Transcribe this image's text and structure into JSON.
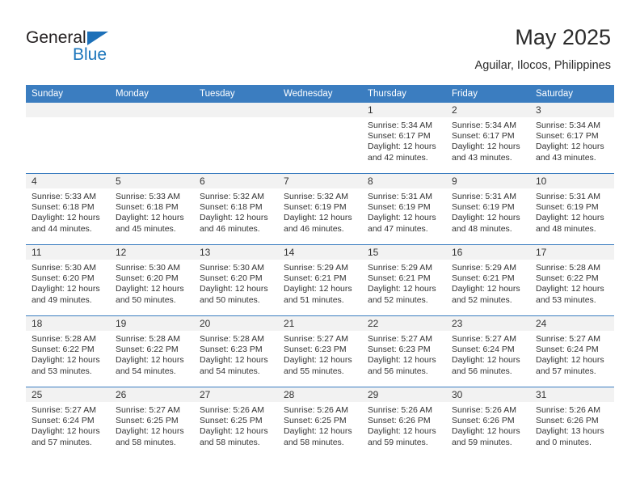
{
  "brand": {
    "name_top": "General",
    "name_bottom": "Blue",
    "triangle_color": "#1d70b8",
    "blue_color": "#1b75bb"
  },
  "header": {
    "month_title": "May 2025",
    "location": "Aguilar, Ilocos, Philippines"
  },
  "theme": {
    "header_blue": "#3b7dc0",
    "daynum_band": "#f2f2f2",
    "text": "#333333"
  },
  "weekday_headers": [
    "Sunday",
    "Monday",
    "Tuesday",
    "Wednesday",
    "Thursday",
    "Friday",
    "Saturday"
  ],
  "labels": {
    "sunrise_prefix": "Sunrise:",
    "sunset_prefix": "Sunset:",
    "daylight_prefix": "Daylight:"
  },
  "weeks": [
    [
      {
        "day": "",
        "blank": true
      },
      {
        "day": "",
        "blank": true
      },
      {
        "day": "",
        "blank": true
      },
      {
        "day": "",
        "blank": true
      },
      {
        "day": "1",
        "sunrise": "Sunrise: 5:34 AM",
        "sunset": "Sunset: 6:17 PM",
        "daylight": "Daylight: 12 hours and 42 minutes."
      },
      {
        "day": "2",
        "sunrise": "Sunrise: 5:34 AM",
        "sunset": "Sunset: 6:17 PM",
        "daylight": "Daylight: 12 hours and 43 minutes."
      },
      {
        "day": "3",
        "sunrise": "Sunrise: 5:34 AM",
        "sunset": "Sunset: 6:17 PM",
        "daylight": "Daylight: 12 hours and 43 minutes."
      }
    ],
    [
      {
        "day": "4",
        "sunrise": "Sunrise: 5:33 AM",
        "sunset": "Sunset: 6:18 PM",
        "daylight": "Daylight: 12 hours and 44 minutes."
      },
      {
        "day": "5",
        "sunrise": "Sunrise: 5:33 AM",
        "sunset": "Sunset: 6:18 PM",
        "daylight": "Daylight: 12 hours and 45 minutes."
      },
      {
        "day": "6",
        "sunrise": "Sunrise: 5:32 AM",
        "sunset": "Sunset: 6:18 PM",
        "daylight": "Daylight: 12 hours and 46 minutes."
      },
      {
        "day": "7",
        "sunrise": "Sunrise: 5:32 AM",
        "sunset": "Sunset: 6:19 PM",
        "daylight": "Daylight: 12 hours and 46 minutes."
      },
      {
        "day": "8",
        "sunrise": "Sunrise: 5:31 AM",
        "sunset": "Sunset: 6:19 PM",
        "daylight": "Daylight: 12 hours and 47 minutes."
      },
      {
        "day": "9",
        "sunrise": "Sunrise: 5:31 AM",
        "sunset": "Sunset: 6:19 PM",
        "daylight": "Daylight: 12 hours and 48 minutes."
      },
      {
        "day": "10",
        "sunrise": "Sunrise: 5:31 AM",
        "sunset": "Sunset: 6:19 PM",
        "daylight": "Daylight: 12 hours and 48 minutes."
      }
    ],
    [
      {
        "day": "11",
        "sunrise": "Sunrise: 5:30 AM",
        "sunset": "Sunset: 6:20 PM",
        "daylight": "Daylight: 12 hours and 49 minutes."
      },
      {
        "day": "12",
        "sunrise": "Sunrise: 5:30 AM",
        "sunset": "Sunset: 6:20 PM",
        "daylight": "Daylight: 12 hours and 50 minutes."
      },
      {
        "day": "13",
        "sunrise": "Sunrise: 5:30 AM",
        "sunset": "Sunset: 6:20 PM",
        "daylight": "Daylight: 12 hours and 50 minutes."
      },
      {
        "day": "14",
        "sunrise": "Sunrise: 5:29 AM",
        "sunset": "Sunset: 6:21 PM",
        "daylight": "Daylight: 12 hours and 51 minutes."
      },
      {
        "day": "15",
        "sunrise": "Sunrise: 5:29 AM",
        "sunset": "Sunset: 6:21 PM",
        "daylight": "Daylight: 12 hours and 52 minutes."
      },
      {
        "day": "16",
        "sunrise": "Sunrise: 5:29 AM",
        "sunset": "Sunset: 6:21 PM",
        "daylight": "Daylight: 12 hours and 52 minutes."
      },
      {
        "day": "17",
        "sunrise": "Sunrise: 5:28 AM",
        "sunset": "Sunset: 6:22 PM",
        "daylight": "Daylight: 12 hours and 53 minutes."
      }
    ],
    [
      {
        "day": "18",
        "sunrise": "Sunrise: 5:28 AM",
        "sunset": "Sunset: 6:22 PM",
        "daylight": "Daylight: 12 hours and 53 minutes."
      },
      {
        "day": "19",
        "sunrise": "Sunrise: 5:28 AM",
        "sunset": "Sunset: 6:22 PM",
        "daylight": "Daylight: 12 hours and 54 minutes."
      },
      {
        "day": "20",
        "sunrise": "Sunrise: 5:28 AM",
        "sunset": "Sunset: 6:23 PM",
        "daylight": "Daylight: 12 hours and 54 minutes."
      },
      {
        "day": "21",
        "sunrise": "Sunrise: 5:27 AM",
        "sunset": "Sunset: 6:23 PM",
        "daylight": "Daylight: 12 hours and 55 minutes."
      },
      {
        "day": "22",
        "sunrise": "Sunrise: 5:27 AM",
        "sunset": "Sunset: 6:23 PM",
        "daylight": "Daylight: 12 hours and 56 minutes."
      },
      {
        "day": "23",
        "sunrise": "Sunrise: 5:27 AM",
        "sunset": "Sunset: 6:24 PM",
        "daylight": "Daylight: 12 hours and 56 minutes."
      },
      {
        "day": "24",
        "sunrise": "Sunrise: 5:27 AM",
        "sunset": "Sunset: 6:24 PM",
        "daylight": "Daylight: 12 hours and 57 minutes."
      }
    ],
    [
      {
        "day": "25",
        "sunrise": "Sunrise: 5:27 AM",
        "sunset": "Sunset: 6:24 PM",
        "daylight": "Daylight: 12 hours and 57 minutes."
      },
      {
        "day": "26",
        "sunrise": "Sunrise: 5:27 AM",
        "sunset": "Sunset: 6:25 PM",
        "daylight": "Daylight: 12 hours and 58 minutes."
      },
      {
        "day": "27",
        "sunrise": "Sunrise: 5:26 AM",
        "sunset": "Sunset: 6:25 PM",
        "daylight": "Daylight: 12 hours and 58 minutes."
      },
      {
        "day": "28",
        "sunrise": "Sunrise: 5:26 AM",
        "sunset": "Sunset: 6:25 PM",
        "daylight": "Daylight: 12 hours and 58 minutes."
      },
      {
        "day": "29",
        "sunrise": "Sunrise: 5:26 AM",
        "sunset": "Sunset: 6:26 PM",
        "daylight": "Daylight: 12 hours and 59 minutes."
      },
      {
        "day": "30",
        "sunrise": "Sunrise: 5:26 AM",
        "sunset": "Sunset: 6:26 PM",
        "daylight": "Daylight: 12 hours and 59 minutes."
      },
      {
        "day": "31",
        "sunrise": "Sunrise: 5:26 AM",
        "sunset": "Sunset: 6:26 PM",
        "daylight": "Daylight: 13 hours and 0 minutes."
      }
    ]
  ]
}
